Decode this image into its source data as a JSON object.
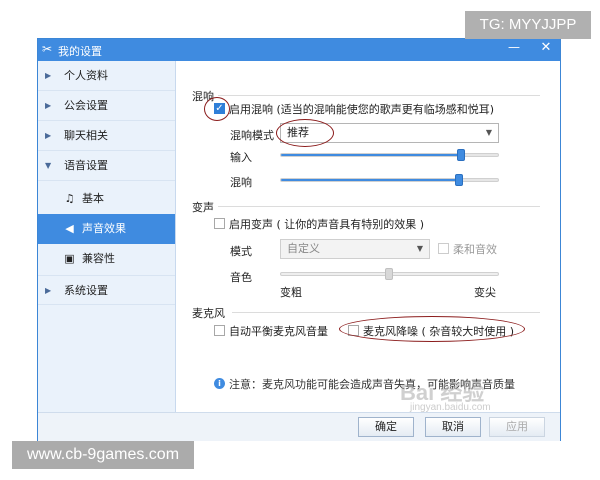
{
  "watermarks": {
    "top": "TG: MYYJJPP",
    "bottom": "www.cb-9games.com",
    "baidu": "Bai 经验",
    "baidu_sub": "jingyan.baidu.com"
  },
  "window": {
    "title": "我的设置",
    "minimize": "—",
    "close": "✕"
  },
  "sidebar": {
    "items": [
      {
        "label": "个人资料"
      },
      {
        "label": "公会设置"
      },
      {
        "label": "聊天相关"
      },
      {
        "label": "语音设置"
      },
      {
        "label": "系统设置"
      }
    ],
    "subitems": [
      {
        "label": "基本"
      },
      {
        "label": "声音效果"
      },
      {
        "label": "兼容性"
      }
    ],
    "active": "声音效果"
  },
  "reverb": {
    "title": "混响",
    "enable_label": "启用混响 (适当的混响能使您的歌声更有临场感和悦耳)",
    "enabled": true,
    "mode_label": "混响模式",
    "mode_value": "推荐",
    "input_label": "输入",
    "input_level": 0.9,
    "reverb_label": "混响",
    "reverb_level": 0.9
  },
  "voice_change": {
    "title": "变声",
    "enable_label": "启用变声 ( 让你的声音具有特别的效果 )",
    "enabled": false,
    "mode_label": "模式",
    "mode_value": "自定义",
    "soft_label": "柔和音效",
    "pitch_label": "音色",
    "pitch_level": 0.5,
    "low_label": "变粗",
    "high_label": "变尖"
  },
  "mic": {
    "title": "麦克风",
    "auto_balance_label": "自动平衡麦克风音量",
    "noise_reduction_label": "麦克风降噪 ( 杂音较大时使用 )",
    "auto_balance": false,
    "noise_reduction": false
  },
  "note": {
    "text": "注意：麦克风功能可能会造成声音失真，可能影响声音质量"
  },
  "buttons": {
    "ok": "确定",
    "cancel": "取消",
    "apply": "应用"
  },
  "colors": {
    "accent": "#3f8be0",
    "annotation": "#8b1c1c"
  }
}
